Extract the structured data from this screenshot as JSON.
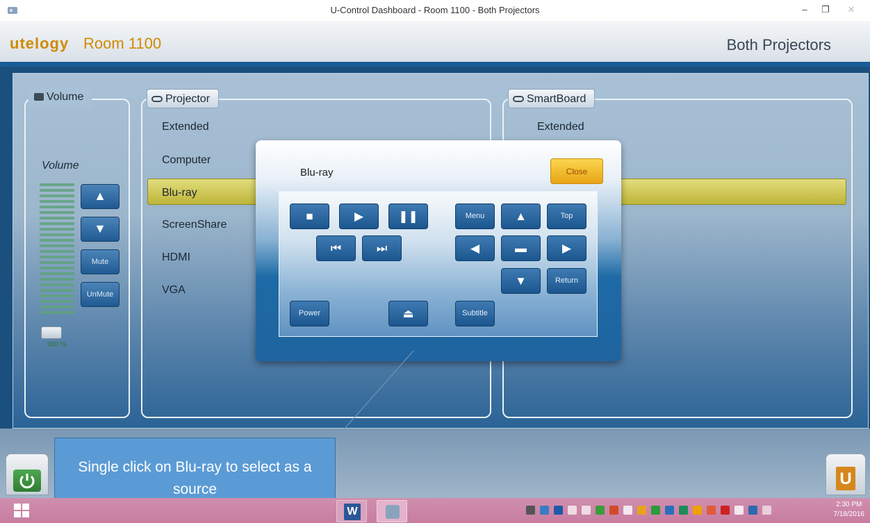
{
  "window": {
    "title": "U-Control Dashboard - Room 1100 - Both Projectors",
    "minimize": "–",
    "maximize": "❐",
    "close": "✕"
  },
  "header": {
    "logo": "utelogy",
    "room": "Room 1100",
    "mode": "Both Projectors"
  },
  "volume_panel": {
    "legend": "Volume",
    "label": "Volume",
    "up": "▲",
    "down": "▼",
    "mute": "Mute",
    "unmute": "UnMute",
    "level_text": "100 %",
    "level": 1.0
  },
  "projector_panel": {
    "legend": "Projector",
    "sources": [
      "Extended",
      "Computer",
      "Blu-ray",
      "ScreenShare",
      "HDMI",
      "VGA"
    ],
    "selected": "Blu-ray"
  },
  "smartboard_panel": {
    "legend": "SmartBoard",
    "sources": [
      "Extended"
    ]
  },
  "dialog": {
    "title": "Blu-ray",
    "close": "Close",
    "buttons": {
      "stop": "■",
      "play": "▶",
      "pause": "❚❚",
      "prev": "⏮",
      "next": "⏭",
      "menu": "Menu",
      "up": "▲",
      "top": "Top",
      "left": "◀",
      "enter": "▬",
      "right": "▶",
      "down": "▼",
      "return": "Return",
      "power": "Power",
      "eject": "⏏",
      "subtitle": "Subtitle"
    }
  },
  "callout": {
    "text": "Single click on Blu-ray to select as a source"
  },
  "taskbar": {
    "time": "2:30 PM",
    "date": "7/18/2016"
  },
  "colors": {
    "accent": "#1a5d96",
    "logo": "#d18a00",
    "selection": "#c9c24a",
    "callout": "#5b9bd5",
    "close_button": "#f2be2f"
  }
}
